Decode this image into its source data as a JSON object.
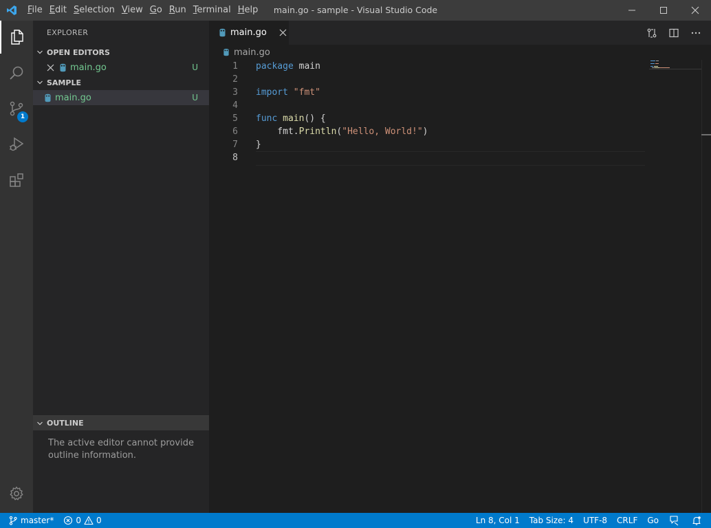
{
  "window": {
    "title": "main.go - sample - Visual Studio Code"
  },
  "menu": {
    "file": {
      "mnemonic": "F",
      "rest": "ile"
    },
    "edit": {
      "mnemonic": "E",
      "rest": "dit"
    },
    "selection": {
      "mnemonic": "S",
      "rest": "election"
    },
    "view": {
      "mnemonic": "V",
      "rest": "iew"
    },
    "go": {
      "mnemonic": "G",
      "rest": "o"
    },
    "run": {
      "mnemonic": "R",
      "rest": "un"
    },
    "terminal": {
      "mnemonic": "T",
      "rest": "erminal"
    },
    "help": {
      "mnemonic": "H",
      "rest": "elp"
    }
  },
  "activity": {
    "source_control_badge": "1"
  },
  "sidebar": {
    "title": "EXPLORER",
    "open_editors": {
      "header": "OPEN EDITORS",
      "file": "main.go",
      "git_status": "U"
    },
    "folder": {
      "header": "SAMPLE",
      "file": "main.go",
      "git_status": "U"
    },
    "outline": {
      "header": "OUTLINE",
      "message": "The active editor cannot provide outline information."
    }
  },
  "editor": {
    "tab_label": "main.go",
    "breadcrumb": "main.go",
    "line_numbers": [
      "1",
      "2",
      "3",
      "4",
      "5",
      "6",
      "7",
      "8"
    ],
    "code": {
      "l1_kw": "package",
      "l1_rest": " main",
      "l3_kw": "import",
      "l3_str": "\"fmt\"",
      "l5_kw": "func",
      "l5_fn": "main",
      "l5_rest": "() {",
      "l6_pre": "    fmt.",
      "l6_fn": "Println",
      "l6_open": "(",
      "l6_str": "\"Hello, World!\"",
      "l6_close": ")",
      "l7": "}"
    }
  },
  "statusbar": {
    "branch": "master*",
    "errors": "0",
    "warnings": "0",
    "cursor": "Ln 8, Col 1",
    "tab_size": "Tab Size: 4",
    "encoding": "UTF-8",
    "eol": "CRLF",
    "language": "Go"
  },
  "colors": {
    "statusbar": "#007acc",
    "activitybar": "#333333",
    "sidebar": "#252526",
    "editor": "#1e1e1e",
    "git_untracked": "#73c991",
    "keyword": "#569cd6",
    "function": "#dcdcaa",
    "string": "#ce9178"
  },
  "icons": {
    "app": "vscode-logo-icon",
    "activity": [
      "files-icon",
      "search-icon",
      "source-control-icon",
      "run-debug-icon",
      "extensions-icon",
      "settings-gear-icon"
    ],
    "file": "go-gopher-icon"
  }
}
